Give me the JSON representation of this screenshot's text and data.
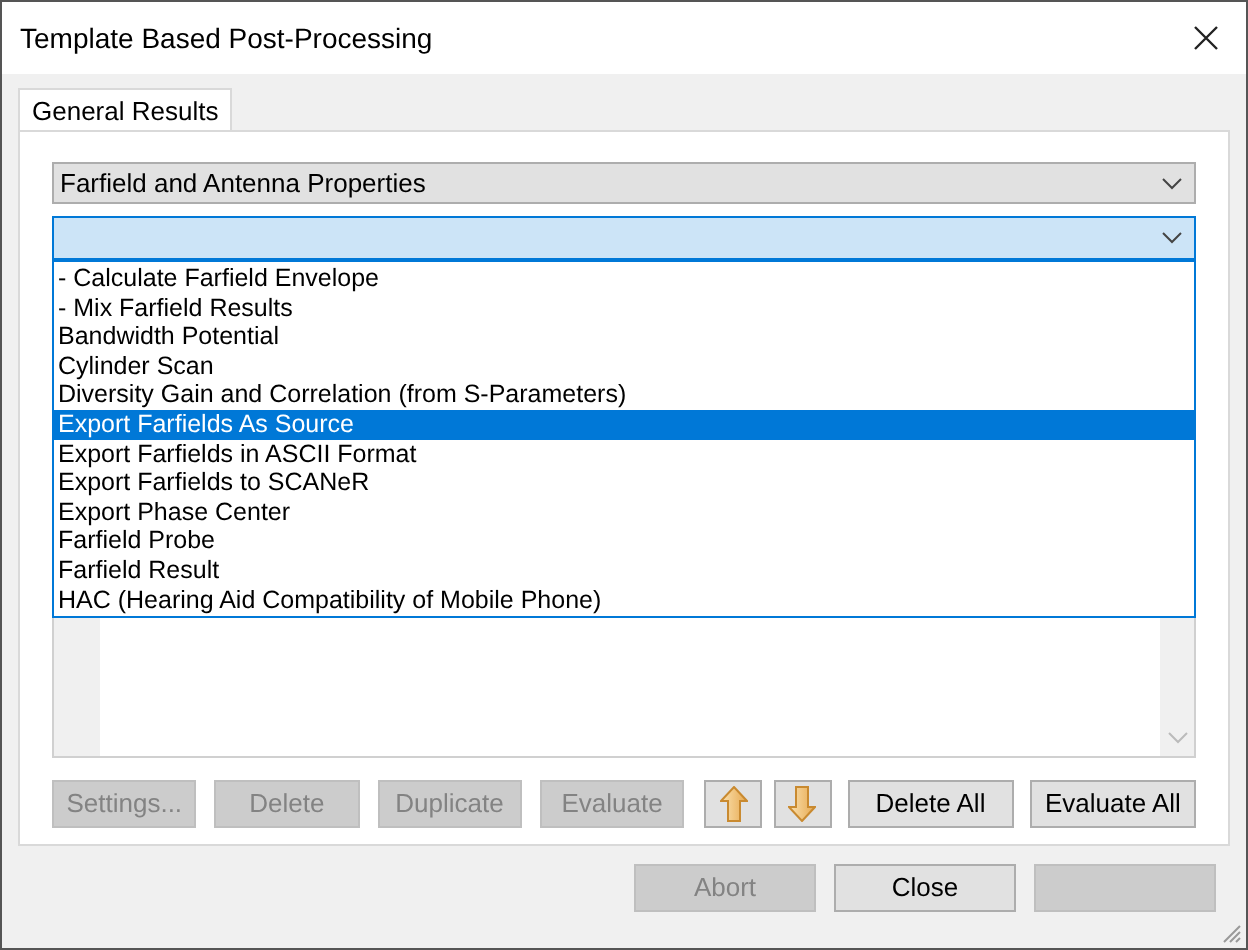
{
  "window": {
    "title": "Template Based Post-Processing"
  },
  "tabs": [
    {
      "label": "General Results",
      "selected": true
    }
  ],
  "category_combo": {
    "value": "Farfield and Antenna Properties"
  },
  "template_combo": {
    "focused": true,
    "expanded": true
  },
  "dropdown_items": [
    {
      "label": "- Calculate Farfield Envelope",
      "selected": false
    },
    {
      "label": "- Mix Farfield Results",
      "selected": false
    },
    {
      "label": "Bandwidth Potential",
      "selected": false
    },
    {
      "label": "Cylinder Scan",
      "selected": false
    },
    {
      "label": "Diversity Gain and Correlation (from S-Parameters)",
      "selected": false
    },
    {
      "label": "Export Farfields As Source",
      "selected": true
    },
    {
      "label": "Export Farfields in ASCII Format",
      "selected": false
    },
    {
      "label": "Export Farfields to SCANeR",
      "selected": false
    },
    {
      "label": "Export Phase Center",
      "selected": false
    },
    {
      "label": "Farfield Probe",
      "selected": false
    },
    {
      "label": "Farfield Result",
      "selected": false
    },
    {
      "label": "HAC (Hearing Aid Compatibility of Mobile Phone)",
      "selected": false
    }
  ],
  "list_buttons": [
    {
      "kind": "text",
      "label": "Settings...",
      "disabled": true
    },
    {
      "kind": "text",
      "label": "Delete",
      "disabled": true
    },
    {
      "kind": "text",
      "label": "Duplicate",
      "disabled": true
    },
    {
      "kind": "text",
      "label": "Evaluate",
      "disabled": true
    },
    {
      "kind": "up",
      "disabled": false
    },
    {
      "kind": "down",
      "disabled": false
    },
    {
      "kind": "text",
      "label": "Delete All",
      "disabled": false
    },
    {
      "kind": "text",
      "label": "Evaluate All",
      "disabled": false
    }
  ],
  "footer_buttons": [
    {
      "label": "Abort",
      "disabled": true
    },
    {
      "label": "Close",
      "disabled": false
    },
    {
      "disabled": true
    }
  ]
}
